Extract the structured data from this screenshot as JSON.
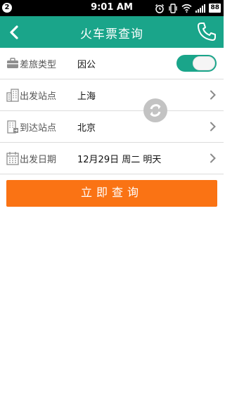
{
  "status_bar": {
    "notification_count": "2",
    "time": "9:01 AM",
    "battery": "88"
  },
  "header": {
    "title": "火车票查询"
  },
  "form": {
    "travel_type": {
      "label": "差旅类型",
      "value": "因公",
      "toggle_on": true
    },
    "departure_station": {
      "label": "出发站点",
      "value": "上海"
    },
    "arrival_station": {
      "label": "到达站点",
      "value": "北京"
    },
    "departure_date": {
      "label": "出发日期",
      "value": "12月29日 周二 明天"
    }
  },
  "actions": {
    "query_label": "立即查询"
  },
  "colors": {
    "header_bg": "#1aa58a",
    "toggle_on": "#1aa58a",
    "button_bg": "#fa7314"
  },
  "icons": [
    "back-arrow-icon",
    "phone-icon",
    "briefcase-icon",
    "building-icon",
    "building-arrival-icon",
    "calendar-icon",
    "chevron-right-icon",
    "swap-stations-icon",
    "alarm-icon",
    "vibrate-icon",
    "wifi-icon",
    "signal-icon",
    "battery-icon"
  ]
}
